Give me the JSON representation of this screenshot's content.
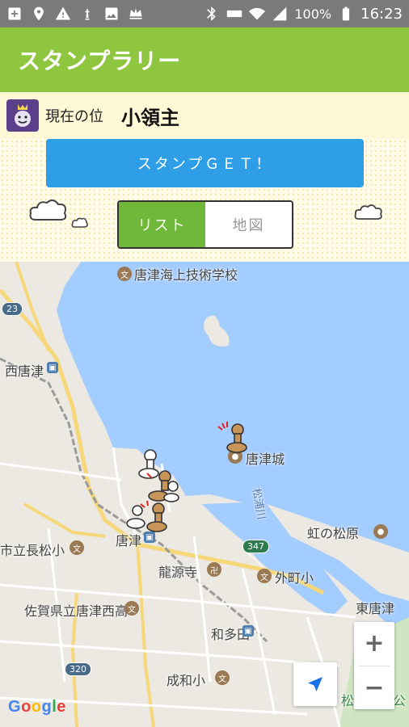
{
  "status": {
    "battery": "100%",
    "time": "16:23",
    "icons": [
      "add-box-icon",
      "location-icon",
      "warning-icon",
      "chess-icon",
      "image-icon",
      "crown-icon",
      "bluetooth-icon",
      "volte-icon",
      "wifi-icon",
      "signal-icon",
      "battery-icon"
    ]
  },
  "app": {
    "title": "スタンプラリー"
  },
  "rank": {
    "label": "現在の位",
    "value": "小領主",
    "icon": "rank-avatar-icon"
  },
  "actions": {
    "stamp_get": "スタンプＧＥＴ！"
  },
  "view_toggle": {
    "list": "リスト",
    "map": "地図",
    "selected": "list"
  },
  "map": {
    "labels": {
      "school_top": "唐津海上技術学校",
      "west_karatsu": "西唐津",
      "karatsu_castle": "唐津城",
      "niji_matsubara": "虹の松原",
      "nagamatsu": "市立長松小",
      "karatsu_station": "唐津",
      "ryugenji": "龍源寺",
      "sotomachi": "外町小",
      "saga_nishi": "佐賀県立唐津西高",
      "higashi_karatsu": "東唐津",
      "wadada": "和多田",
      "seiwa": "成和小",
      "matsuura_river": "松浦川",
      "matsuura_kasen": "松浦河畔公"
    },
    "routes": {
      "r23": "23",
      "r347": "347",
      "r320": "320"
    },
    "zoom_in": "+",
    "zoom_out": "−",
    "attribution": "Google",
    "colors": {
      "water": "#a3ccff",
      "land": "#ebe9e2",
      "road": "#ffffff",
      "highway": "#f6d77a"
    }
  }
}
